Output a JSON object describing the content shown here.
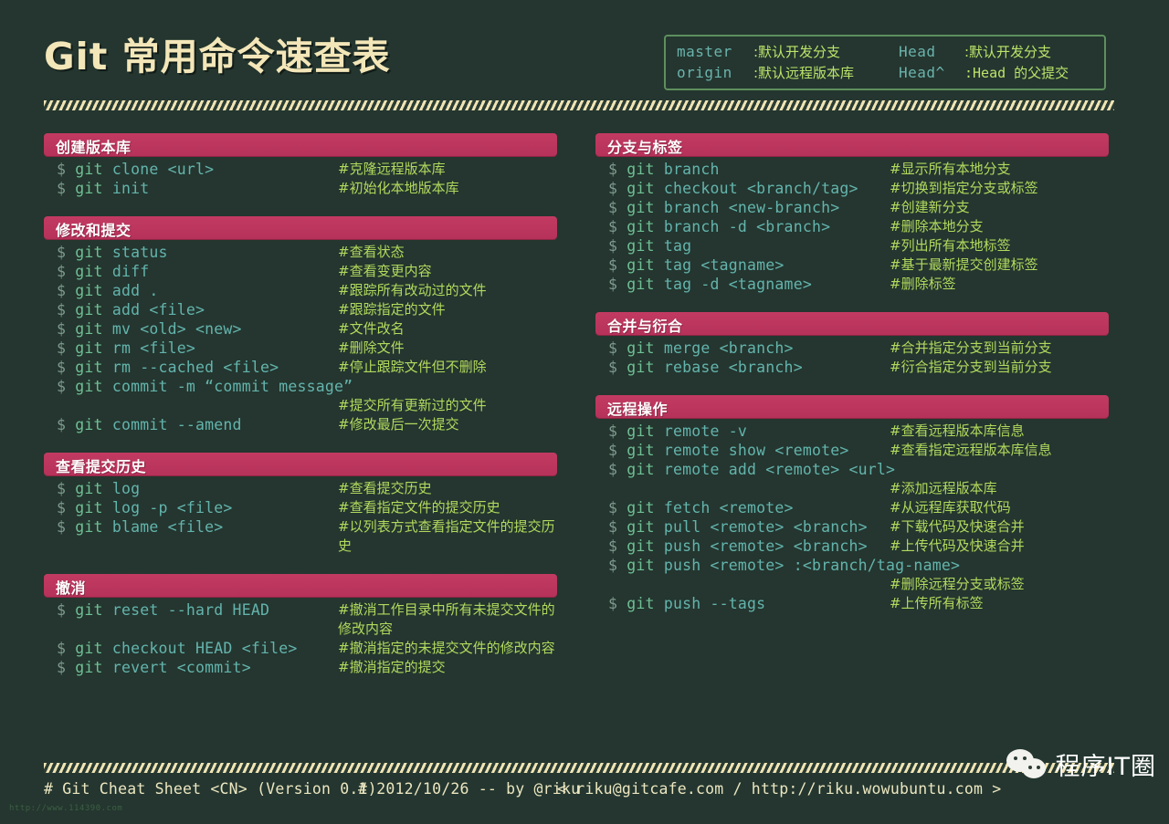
{
  "page": {
    "title": "Git 常用命令速查表",
    "background_color": "#24362f",
    "accent_color": "#c23a62",
    "title_color": "#f3e6b8",
    "command_color": "#63b4ad",
    "comment_color": "#b3d95e"
  },
  "legend": {
    "rows": [
      {
        "key_a": "master",
        "val_a": ":默认开发分支",
        "key_b": "Head",
        "val_b": ":默认开发分支"
      },
      {
        "key_a": "origin",
        "val_a": ":默认远程版本库",
        "key_b": "Head^",
        "val_b": ":Head 的父提交"
      }
    ]
  },
  "left_column": [
    {
      "title": "创建版本库",
      "rows": [
        {
          "prompt": "$ ",
          "git": "git",
          "args": " clone <url>",
          "comment": "#克隆远程版本库"
        },
        {
          "prompt": "$ ",
          "git": "git",
          "args": " init",
          "comment": "#初始化本地版本库"
        }
      ]
    },
    {
      "title": "修改和提交",
      "rows": [
        {
          "prompt": "$ ",
          "git": "git",
          "args": " status",
          "comment": "#查看状态"
        },
        {
          "prompt": "$ ",
          "git": "git",
          "args": " diff",
          "comment": "#查看变更内容"
        },
        {
          "prompt": "$ ",
          "git": "git",
          "args": " add .",
          "comment": "#跟踪所有改动过的文件"
        },
        {
          "prompt": "$ ",
          "git": "git",
          "args": " add <file>",
          "comment": "#跟踪指定的文件"
        },
        {
          "prompt": "$ ",
          "git": "git",
          "args": " mv <old> <new>",
          "comment": "#文件改名"
        },
        {
          "prompt": "$ ",
          "git": "git",
          "args": " rm <file>",
          "comment": "#删除文件"
        },
        {
          "prompt": "$ ",
          "git": "git",
          "args": " rm --cached <file>",
          "comment": "#停止跟踪文件但不删除"
        },
        {
          "prompt": "$ ",
          "git": "git",
          "args": " commit -m “commit message”",
          "comment": ""
        },
        {
          "prompt": "",
          "git": "",
          "args": "",
          "comment": "#提交所有更新过的文件",
          "orphan": true
        },
        {
          "prompt": "$ ",
          "git": "git",
          "args": " commit --amend",
          "comment": "#修改最后一次提交"
        }
      ]
    },
    {
      "title": "查看提交历史",
      "rows": [
        {
          "prompt": "$ ",
          "git": "git",
          "args": " log",
          "comment": "#查看提交历史"
        },
        {
          "prompt": "$ ",
          "git": "git",
          "args": " log -p <file>",
          "comment": "#查看指定文件的提交历史"
        },
        {
          "prompt": "$ ",
          "git": "git",
          "args": " blame <file>",
          "comment": "#以列表方式查看指定文件的提交历史"
        }
      ]
    },
    {
      "title": "撤消",
      "rows": [
        {
          "prompt": "$ ",
          "git": "git",
          "args": " reset --hard HEAD",
          "comment": "#撤消工作目录中所有未提交文件的修改内容"
        },
        {
          "prompt": "$ ",
          "git": "git",
          "args": " checkout HEAD <file>",
          "comment": "#撤消指定的未提交文件的修改内容"
        },
        {
          "prompt": "$ ",
          "git": "git",
          "args": " revert <commit>",
          "comment": "#撤消指定的提交"
        }
      ]
    }
  ],
  "right_column": [
    {
      "title": "分支与标签",
      "rows": [
        {
          "prompt": "$ ",
          "git": "git",
          "args": " branch",
          "comment": "#显示所有本地分支"
        },
        {
          "prompt": "$ ",
          "git": "git",
          "args": " checkout <branch/tag>",
          "comment": "#切换到指定分支或标签"
        },
        {
          "prompt": "$ ",
          "git": "git",
          "args": " branch <new-branch>",
          "comment": "#创建新分支"
        },
        {
          "prompt": "$ ",
          "git": "git",
          "args": " branch -d <branch>",
          "comment": "#删除本地分支"
        },
        {
          "prompt": "$ ",
          "git": "git",
          "args": " tag",
          "comment": "#列出所有本地标签"
        },
        {
          "prompt": "$ ",
          "git": "git",
          "args": " tag <tagname>",
          "comment": "#基于最新提交创建标签"
        },
        {
          "prompt": "$ ",
          "git": "git",
          "args": " tag -d <tagname>",
          "comment": "#删除标签"
        }
      ]
    },
    {
      "title": "合并与衍合",
      "rows": [
        {
          "prompt": "$ ",
          "git": "git",
          "args": " merge <branch>",
          "comment": "#合并指定分支到当前分支"
        },
        {
          "prompt": "$ ",
          "git": "git",
          "args": " rebase <branch>",
          "comment": "#衍合指定分支到当前分支"
        }
      ]
    },
    {
      "title": "远程操作",
      "rows": [
        {
          "prompt": "$ ",
          "git": "git",
          "args": " remote -v",
          "comment": "#查看远程版本库信息"
        },
        {
          "prompt": "$ ",
          "git": "git",
          "args": " remote show <remote>",
          "comment": "#查看指定远程版本库信息"
        },
        {
          "prompt": "$ ",
          "git": "git",
          "args": " remote add <remote> <url>",
          "comment": ""
        },
        {
          "prompt": "",
          "git": "",
          "args": "",
          "comment": "#添加远程版本库",
          "orphan": true
        },
        {
          "prompt": "$ ",
          "git": "git",
          "args": " fetch <remote>",
          "comment": "#从远程库获取代码"
        },
        {
          "prompt": "$ ",
          "git": "git",
          "args": " pull <remote> <branch>",
          "comment": "#下载代码及快速合并"
        },
        {
          "prompt": "$ ",
          "git": "git",
          "args": " push <remote> <branch>",
          "comment": "#上传代码及快速合并"
        },
        {
          "prompt": "$ ",
          "git": "git",
          "args": " push <remote> :<branch/tag-name>",
          "comment": ""
        },
        {
          "prompt": "",
          "git": "",
          "args": "",
          "comment": "#删除远程分支或标签",
          "orphan": true
        },
        {
          "prompt": "$ ",
          "git": "git",
          "args": " push --tags",
          "comment": "#上传所有标签"
        }
      ]
    }
  ],
  "footer": {
    "left": "# Git Cheat Sheet <CN> (Version 0.1)",
    "date": "# 2012/10/26  -- by @riku",
    "contact": "< riku@gitcafe.com / http://riku.wowubuntu.com >"
  },
  "watermark": "http://www.114390.com",
  "brand": {
    "name": "程序IT圈",
    "icon": "wechat-icon"
  }
}
